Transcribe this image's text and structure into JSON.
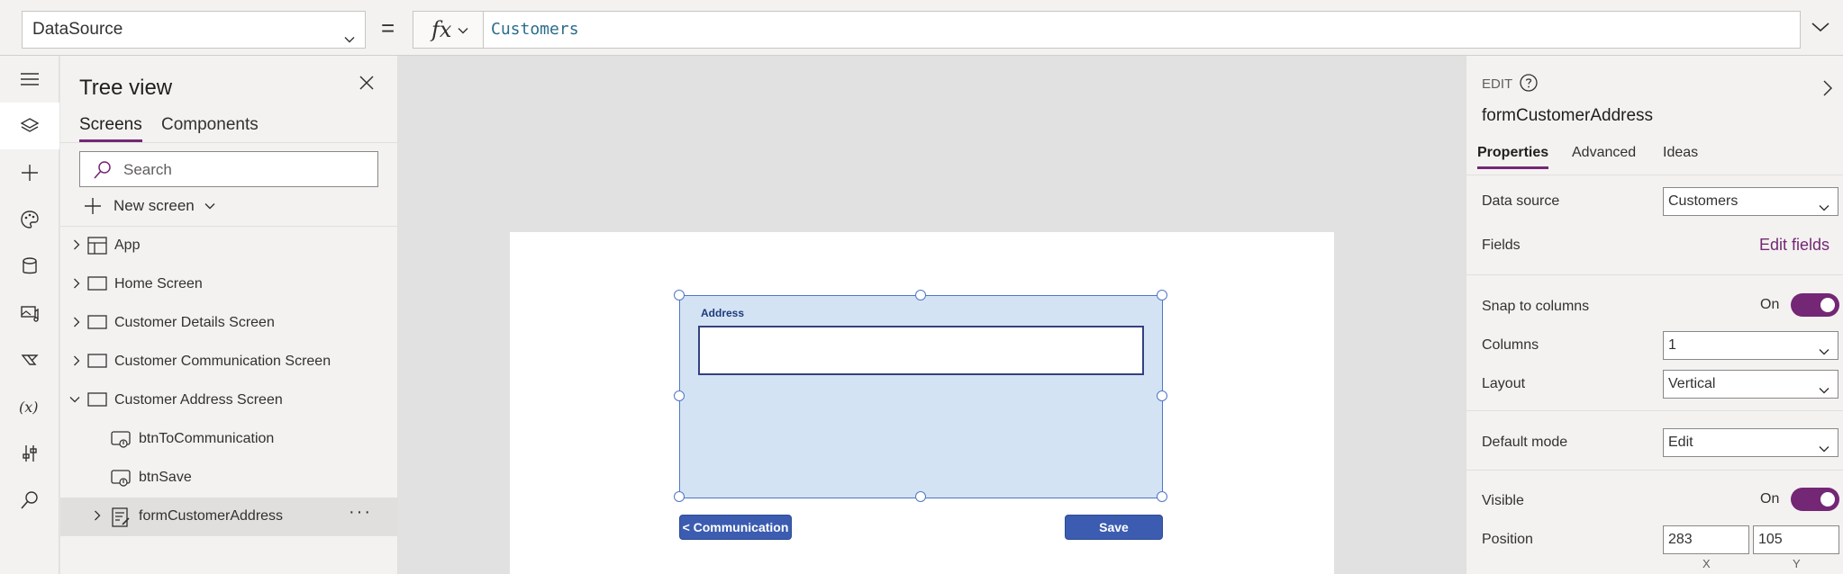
{
  "formula_bar": {
    "property": "DataSource",
    "fx_label": "fx",
    "formula": "Customers"
  },
  "tree": {
    "title": "Tree view",
    "tabs": [
      {
        "label": "Screens",
        "active": true
      },
      {
        "label": "Components",
        "active": false
      }
    ],
    "search_placeholder": "Search",
    "new_screen_label": "New screen",
    "items": [
      {
        "label": "App",
        "icon": "app-icon",
        "expanded": false
      },
      {
        "label": "Home Screen",
        "icon": "screen-icon",
        "expanded": false
      },
      {
        "label": "Customer Details Screen",
        "icon": "screen-icon",
        "expanded": false
      },
      {
        "label": "Customer Communication Screen",
        "icon": "screen-icon",
        "expanded": false
      },
      {
        "label": "Customer Address Screen",
        "icon": "screen-icon",
        "expanded": true
      },
      {
        "label": "btnToCommunication",
        "icon": "button-control-icon",
        "child": true
      },
      {
        "label": "btnSave",
        "icon": "button-control-icon",
        "child": true
      },
      {
        "label": "formCustomerAddress",
        "icon": "form-control-icon",
        "child": true,
        "selected": true,
        "more": "···"
      }
    ]
  },
  "canvas": {
    "form_label": "Address",
    "btn_communication": "< Communication",
    "btn_save": "Save"
  },
  "properties": {
    "edit_label": "EDIT",
    "control_name": "formCustomerAddress",
    "tabs": [
      {
        "label": "Properties",
        "active": true
      },
      {
        "label": "Advanced",
        "active": false
      },
      {
        "label": "Ideas",
        "active": false
      }
    ],
    "data_source": {
      "label": "Data source",
      "value": "Customers"
    },
    "fields": {
      "label": "Fields",
      "link": "Edit fields"
    },
    "snap_to_columns": {
      "label": "Snap to columns",
      "state": "On",
      "on": true
    },
    "columns": {
      "label": "Columns",
      "value": "1"
    },
    "layout": {
      "label": "Layout",
      "value": "Vertical"
    },
    "default_mode": {
      "label": "Default mode",
      "value": "Edit"
    },
    "visible": {
      "label": "Visible",
      "state": "On",
      "on": true
    },
    "position": {
      "label": "Position",
      "x": "283",
      "y": "105",
      "x_caption": "X",
      "y_caption": "Y"
    }
  },
  "colors": {
    "accent": "#742774",
    "form_fill": "#d4e3f3",
    "button_fill": "#3b5cb0",
    "formula_text": "#2b6d8c"
  }
}
